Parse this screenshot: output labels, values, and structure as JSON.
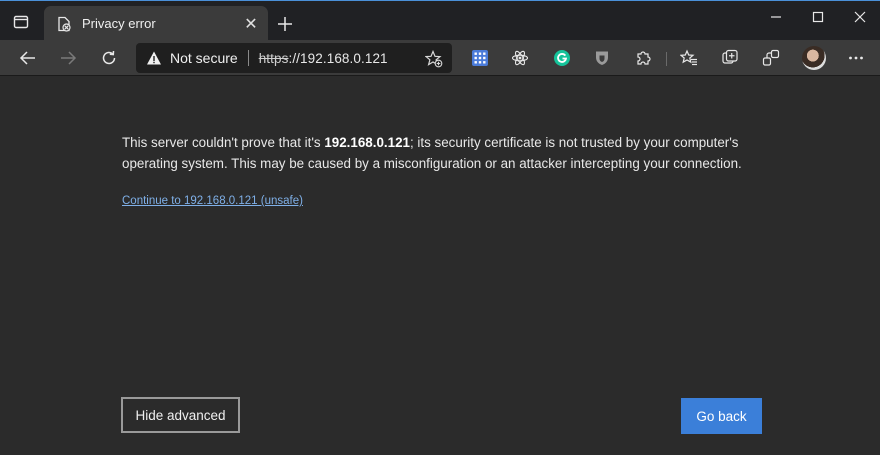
{
  "tab": {
    "title": "Privacy error",
    "close_glyph": "✕",
    "new_tab_glyph": "+"
  },
  "window": {
    "minimize": "–",
    "maximize": "☐",
    "close": "✕"
  },
  "omnibox": {
    "security_label": "Not secure",
    "url_scheme": "https",
    "url_rest": "://192.168.0.121"
  },
  "icons": {
    "tab_actions": "tab-actions-icon",
    "favicon": "warning-page-icon",
    "back": "back-arrow-icon",
    "forward": "forward-arrow-icon",
    "refresh": "refresh-icon",
    "warning": "warning-triangle-icon",
    "add_favorite": "add-favorite-icon",
    "extensions": [
      "grid-extension-icon",
      "react-extension-icon",
      "grammarly-extension-icon",
      "shield-extension-icon",
      "puzzle-extensions-icon"
    ],
    "right": [
      "favorites-icon",
      "collections-icon",
      "share-icon",
      "more-icon"
    ]
  },
  "content": {
    "message_pre": "This server couldn't prove that it's ",
    "host": "192.168.0.121",
    "message_post": "; its security certificate is not trusted by your computer's operating system. This may be caused by a misconfiguration or an attacker intercepting your connection.",
    "continue_link": "Continue to 192.168.0.121 (unsafe)",
    "hide_advanced": "Hide advanced",
    "go_back": "Go back"
  },
  "colors": {
    "accent": "#3b7fd9",
    "link": "#7fb0e8",
    "page_bg": "#2b2b2b",
    "toolbar_bg": "#3b3b3b"
  }
}
